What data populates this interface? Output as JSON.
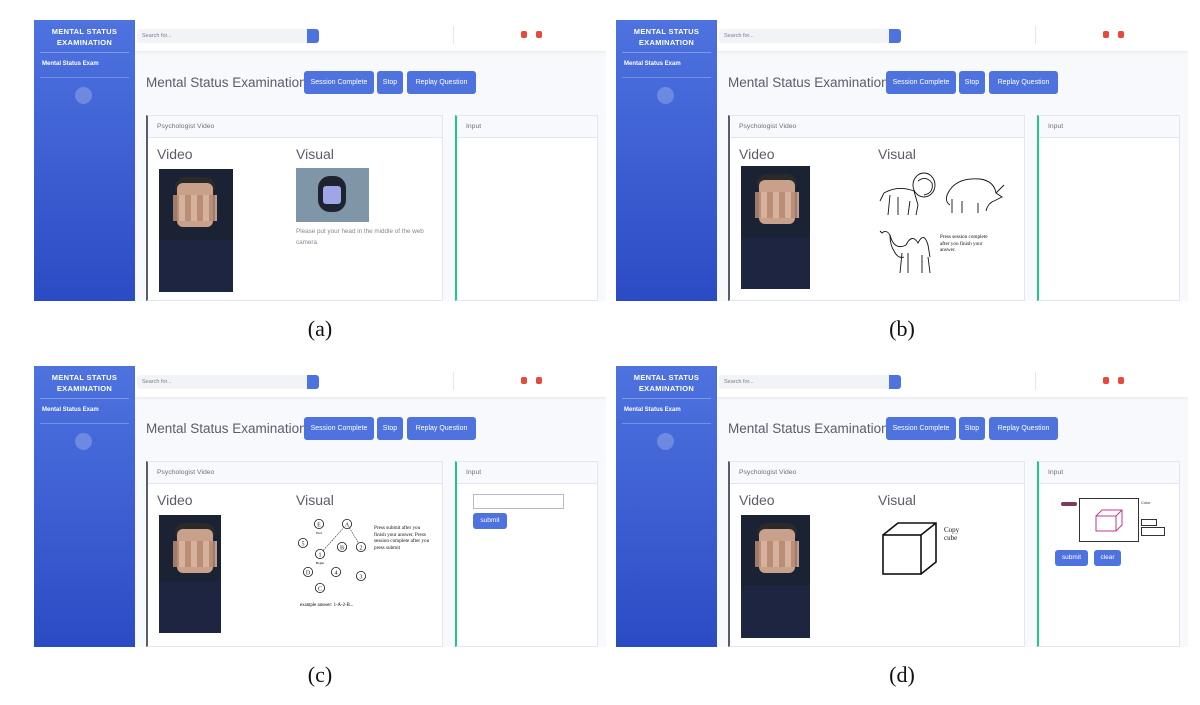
{
  "app": {
    "brand": "MENTAL STATUS EXAMINATION",
    "nav_item": "Mental Status Exam",
    "search_placeholder": "Search for...",
    "page_title": "Mental Status Examination",
    "buttons": {
      "session_complete": "Session Complete",
      "stop": "Stop",
      "replay_question": "Replay Question"
    },
    "cards": {
      "psychologist_video": "Psychologist Video",
      "input": "Input",
      "video_title": "Video",
      "visual_title": "Visual"
    },
    "accent_color": "#4e73df",
    "input_border_color": "#1cc88a",
    "alert_color": "#e74a3b"
  },
  "panels": [
    {
      "caption": "(a)",
      "visual_hint": "Please put your head in the middle of the web camera."
    },
    {
      "caption": "(b)",
      "visual_text": "Press session complete after you finish your answer.",
      "animals": [
        "lion-drawing",
        "rhinoceros-drawing",
        "camel-drawing"
      ]
    },
    {
      "caption": "(c)",
      "visual_text": "Press submit after you finish your answer. Press session complete after you press submit",
      "trail_labels": [
        "E",
        "A",
        "5",
        "1",
        "B",
        "2",
        "D",
        "4",
        "3",
        "C"
      ],
      "trail_sub_labels": {
        "e": "End",
        "one": "Begin"
      },
      "bottom_text": "example answer: 1-A-2-B...",
      "submit_label": "submit"
    },
    {
      "caption": "(d)",
      "copy_text": "Copy cube",
      "submit_label": "submit",
      "clear_label": "clear",
      "pen_label": "Color"
    }
  ]
}
